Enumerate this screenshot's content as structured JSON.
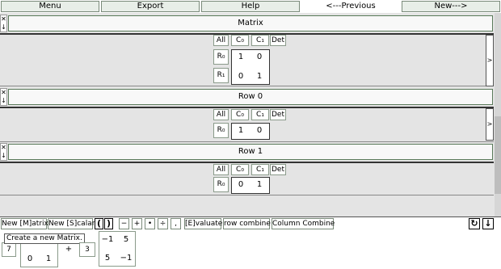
{
  "topbar": {
    "buttons": [
      "Menu",
      "Export",
      "Help",
      "<---Previous",
      "New--->"
    ]
  },
  "side_controls": {
    "close": "✕",
    "down": "↓"
  },
  "panels": [
    {
      "title": "Matrix",
      "headers": [
        "All",
        "C₀",
        "C₁",
        "Det"
      ],
      "rows": [
        "R₀",
        "R₁"
      ],
      "values": [
        [
          "1",
          "0"
        ],
        [
          "0",
          "1"
        ]
      ],
      "more": ">"
    },
    {
      "title": "Row 0",
      "headers": [
        "All",
        "C₀",
        "C₁",
        "Det"
      ],
      "rows": [
        "R₀"
      ],
      "values": [
        [
          "1",
          "0"
        ]
      ],
      "more": ">"
    },
    {
      "title": "Row 1",
      "headers": [
        "All",
        "C₀",
        "C₁",
        "Det"
      ],
      "rows": [
        "R₀"
      ],
      "values": [
        [
          "0",
          "1"
        ]
      ]
    }
  ],
  "toolbar": {
    "new_matrix": "New [M]atrix",
    "new_scalar": "New [S]calar",
    "lparen": "(",
    "rparen": ")",
    "minus": "−",
    "plus": "+",
    "dot": "•",
    "divide": "÷",
    "comma": ",",
    "evaluate": "[E]valuate",
    "row_combine": "row combine",
    "column_combine": "Column Combine",
    "undo_icon": "↻",
    "down_icon": "↓"
  },
  "expression": {
    "tooltip": "Create a new Matrix.",
    "scalar1": "7",
    "matrix1_row2": [
      "0",
      "1"
    ],
    "plus": "+",
    "scalar2": "3",
    "matrix2": [
      [
        "−1",
        "5"
      ],
      [
        "5",
        "−1"
      ]
    ]
  }
}
